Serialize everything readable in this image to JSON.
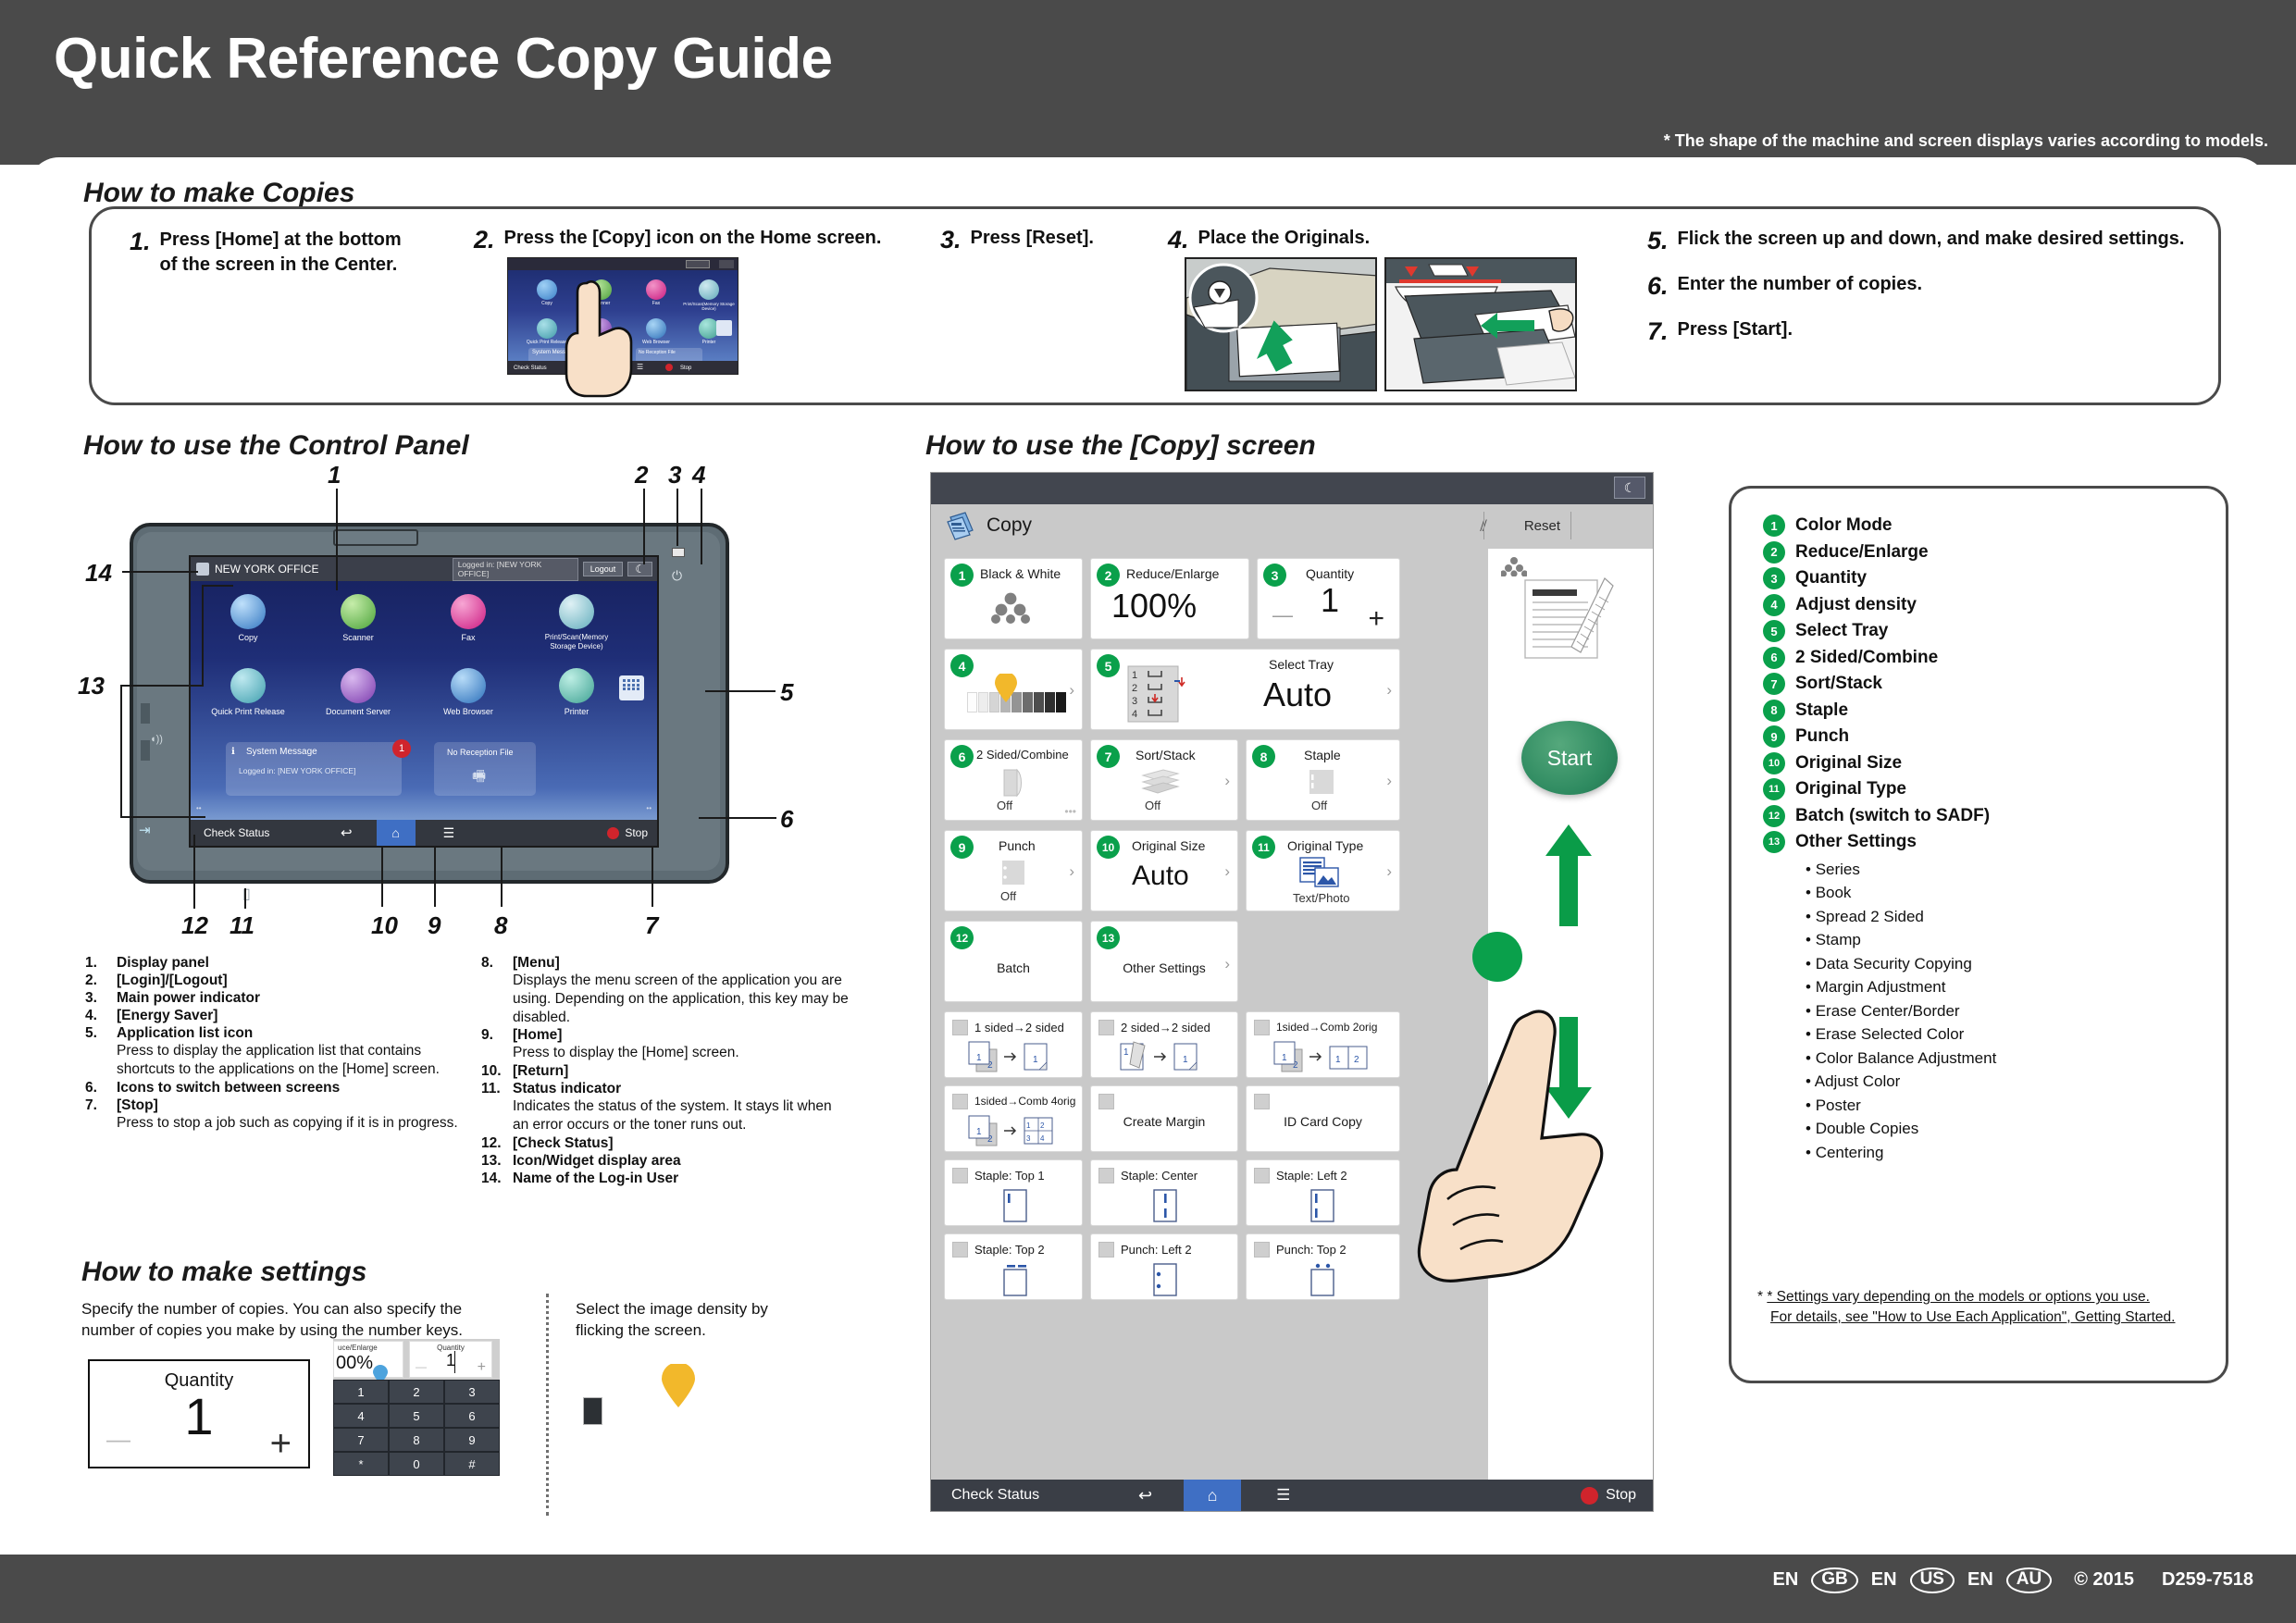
{
  "header": {
    "title": "Quick Reference Copy Guide",
    "note": "* The shape of the machine and screen displays varies according to models."
  },
  "footer": {
    "langs": [
      {
        "code": "EN",
        "region": "GB"
      },
      {
        "code": "EN",
        "region": "US"
      },
      {
        "code": "EN",
        "region": "AU"
      }
    ],
    "copyright": "© 2015",
    "part_number": "D259-7518"
  },
  "how_to_make_copies": {
    "heading": "How to make Copies",
    "steps": [
      {
        "num": "1.",
        "text": "Press [Home] at the bottom\nof the screen in the Center."
      },
      {
        "num": "2.",
        "text": "Press the [Copy] icon on the Home screen."
      },
      {
        "num": "3.",
        "text": "Press [Reset]."
      },
      {
        "num": "4.",
        "text": "Place the Originals."
      },
      {
        "num": "5.",
        "text": "Flick the screen up and down, and make desired settings."
      },
      {
        "num": "6.",
        "text": "Enter the number of copies."
      },
      {
        "num": "7.",
        "text": "Press [Start]."
      }
    ]
  },
  "control_panel": {
    "heading": "How to use the Control Panel",
    "callouts": [
      "1",
      "2",
      "3",
      "4",
      "5",
      "6",
      "7",
      "8",
      "9",
      "10",
      "11",
      "12",
      "13",
      "14"
    ],
    "home_screen": {
      "user_name": "NEW YORK OFFICE",
      "logged_in": "Logged in: [NEW YORK OFFICE]",
      "logout_label": "Logout",
      "apps_row1": [
        "Copy",
        "Scanner",
        "Fax",
        "Print/Scan(Memory Storage Device)"
      ],
      "apps_row2": [
        "Quick Print Release",
        "Document Server",
        "Web Browser",
        "Printer"
      ],
      "system_message_title": "System Message",
      "system_message_body": "Logged in: [NEW YORK OFFICE]",
      "badge_count": "1",
      "reception_label": "No Reception File",
      "bottom_bar": [
        "Check Status",
        "Stop"
      ]
    },
    "legend_left": [
      {
        "n": "1.",
        "label": "Display panel",
        "desc": ""
      },
      {
        "n": "2.",
        "label": "[Login]/[Logout]",
        "desc": ""
      },
      {
        "n": "3.",
        "label": "Main power indicator",
        "desc": ""
      },
      {
        "n": "4.",
        "label": "[Energy Saver]",
        "desc": ""
      },
      {
        "n": "5.",
        "label": "Application list icon",
        "desc": "Press to display the application list that contains shortcuts to the applications on the [Home] screen."
      },
      {
        "n": "6.",
        "label": "Icons to switch between screens",
        "desc": ""
      },
      {
        "n": "7.",
        "label": "[Stop]",
        "desc": "Press to stop a job such as copying if it is in progress."
      }
    ],
    "legend_right": [
      {
        "n": "8.",
        "label": "[Menu]",
        "desc": "Displays the menu screen of the application you are using. Depending on the application, this key may be disabled."
      },
      {
        "n": "9.",
        "label": "[Home]",
        "desc": "Press to display the [Home] screen."
      },
      {
        "n": "10.",
        "label": "[Return]",
        "desc": ""
      },
      {
        "n": "11.",
        "label": "Status indicator",
        "desc": "Indicates the status of the system. It stays lit when an error occurs or the toner runs out."
      },
      {
        "n": "12.",
        "label": "[Check Status]",
        "desc": ""
      },
      {
        "n": "13.",
        "label": "Icon/Widget display area",
        "desc": ""
      },
      {
        "n": "14.",
        "label": "Name of the Log-in User",
        "desc": ""
      }
    ]
  },
  "make_settings": {
    "heading": "How to make settings",
    "left_text": "Specify the number of copies. You can also specify the number of copies you make by using the number keys.",
    "right_text": "Select the image density by flicking the screen.",
    "quantity_label": "Quantity",
    "quantity_value": "1",
    "minus": "—",
    "plus": "+",
    "reduce_enlarge_label": "uce/Enlarge",
    "reduce_enlarge_value": "00%",
    "numpad_keys": [
      "1",
      "2",
      "3",
      "4",
      "5",
      "6",
      "7",
      "8",
      "9",
      "*",
      "0",
      "#"
    ],
    "density_swatches": [
      "#fdfdfd",
      "#e2e2e2",
      "#c8c8c8",
      "#a9a9a9",
      "#7f8b92",
      "#50565d",
      "#2c3034"
    ]
  },
  "copy_screen": {
    "heading": "How to use the [Copy] screen",
    "app_title": "Copy",
    "reset_label": "Reset",
    "start_label": "Start",
    "bottom_bar": {
      "check_status": "Check Status",
      "stop": "Stop"
    },
    "tiles": [
      {
        "num": "1",
        "title": "Black & White",
        "value": "",
        "icon": "dots-triangle-icon",
        "chevron": false
      },
      {
        "num": "2",
        "title": "Reduce/Enlarge",
        "value": "100%",
        "icon": "",
        "chevron": false
      },
      {
        "num": "3",
        "title": "Quantity",
        "value": "1",
        "icon": "stepper",
        "chevron": false
      },
      {
        "num": "4",
        "title": "",
        "value": "",
        "icon": "density-strip-icon",
        "chevron": true
      },
      {
        "num": "5",
        "title": "Select Tray",
        "value": "Auto",
        "icon": "tray-icon",
        "chevron": true
      },
      {
        "num": "6",
        "title": "2 Sided/Combine",
        "value": "Off",
        "icon": "page-fold-icon",
        "chevron": false
      },
      {
        "num": "7",
        "title": "Sort/Stack",
        "value": "Off",
        "icon": "stack-icon",
        "chevron": true
      },
      {
        "num": "8",
        "title": "Staple",
        "value": "Off",
        "icon": "staple-icon",
        "chevron": true
      },
      {
        "num": "9",
        "title": "Punch",
        "value": "Off",
        "icon": "punch-icon",
        "chevron": true
      },
      {
        "num": "10",
        "title": "Original Size",
        "value": "Auto",
        "icon": "",
        "chevron": true
      },
      {
        "num": "11",
        "title": "Original Type",
        "value": "Text/Photo",
        "icon": "text-photo-icon",
        "chevron": true
      },
      {
        "num": "12",
        "title": "Batch",
        "value": "",
        "icon": "",
        "chevron": false
      },
      {
        "num": "13",
        "title": "Other Settings",
        "value": "",
        "icon": "",
        "chevron": true
      }
    ],
    "options": [
      {
        "label": "1 sided→2 sided",
        "icon": "sheets-1to2"
      },
      {
        "label": "2 sided→2 sided",
        "icon": "sheets-2to2"
      },
      {
        "label": "1sided→Comb 2orig",
        "icon": "sheets-comb2"
      },
      {
        "label": "1sided→Comb 4orig",
        "icon": "sheets-comb4"
      },
      {
        "label": "Create Margin",
        "icon": ""
      },
      {
        "label": "ID Card Copy",
        "icon": ""
      },
      {
        "label": "Staple: Top 1",
        "icon": "staple-top1"
      },
      {
        "label": "Staple: Center",
        "icon": "staple-center"
      },
      {
        "label": "Staple: Left 2",
        "icon": "staple-left2"
      },
      {
        "label": "Staple: Top 2",
        "icon": "staple-top2"
      },
      {
        "label": "Punch: Left 2",
        "icon": "punch-left2"
      },
      {
        "label": "Punch: Top 2",
        "icon": "punch-top2"
      }
    ]
  },
  "copy_legend": {
    "items": [
      {
        "n": "1",
        "label": "Color Mode"
      },
      {
        "n": "2",
        "label": "Reduce/Enlarge"
      },
      {
        "n": "3",
        "label": "Quantity"
      },
      {
        "n": "4",
        "label": "Adjust density"
      },
      {
        "n": "5",
        "label": "Select Tray"
      },
      {
        "n": "6",
        "label": "2 Sided/Combine"
      },
      {
        "n": "7",
        "label": "Sort/Stack"
      },
      {
        "n": "8",
        "label": "Staple"
      },
      {
        "n": "9",
        "label": "Punch"
      },
      {
        "n": "10",
        "label": "Original Size"
      },
      {
        "n": "11",
        "label": "Original Type"
      },
      {
        "n": "12",
        "label": "Batch (switch to SADF)"
      },
      {
        "n": "13",
        "label": "Other Settings"
      }
    ],
    "other_settings": [
      "Series",
      "Book",
      "Spread 2 Sided",
      "Stamp",
      "Data Security Copying",
      "Margin Adjustment",
      "Erase Center/Border",
      "Erase Selected Color",
      "Color Balance Adjustment",
      "Adjust Color",
      "Poster",
      "Double Copies",
      "Centering"
    ],
    "note_line1": "* Settings vary depending on the models or options you use.",
    "note_line2": "For details, see \"How to Use Each Application\", Getting Started."
  },
  "colors": {
    "header_bg": "#4a4a4a",
    "accent_green": "#0aa04b",
    "arrow_green": "#0a9c48",
    "start_green": "#2e8a60",
    "badge_red": "#d0242c",
    "home_blue": "#3f6fc4",
    "marker_yellow": "#f2b82b"
  }
}
